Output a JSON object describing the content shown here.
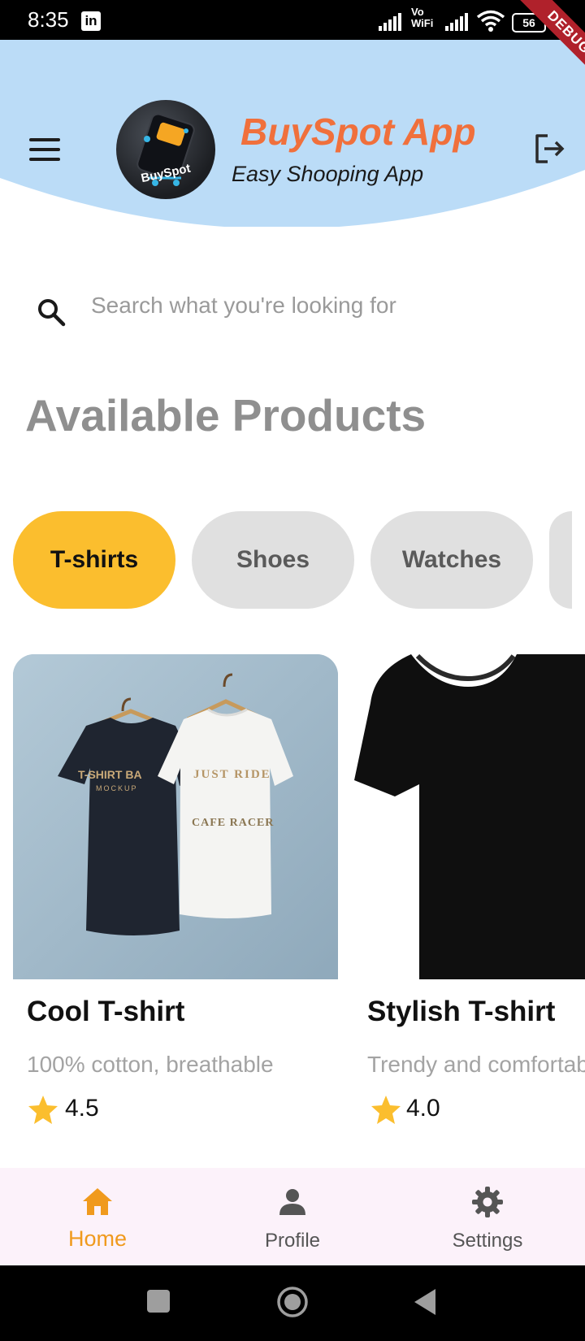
{
  "status_bar": {
    "time": "8:35",
    "notification_icon": "linkedin-icon",
    "network_label_top": "Vo",
    "network_label_bottom": "WiFi",
    "battery_level": "56",
    "debug_ribbon": "DEBUG"
  },
  "header": {
    "title": "BuySpot App",
    "subtitle": "Easy Shooping App",
    "logo_text": "BuySpot",
    "menu_icon": "menu-icon",
    "logout_icon": "logout-icon",
    "background_color": "#bbdcf7",
    "title_color": "#f0703c"
  },
  "search": {
    "placeholder": "Search what you're looking for",
    "value": ""
  },
  "section_title": "Available Products",
  "categories": [
    {
      "label": "T-shirts",
      "active": true
    },
    {
      "label": "Shoes",
      "active": false
    },
    {
      "label": "Watches",
      "active": false
    }
  ],
  "products": [
    {
      "name": "Cool T-shirt",
      "description": "100% cotton, breathable",
      "rating": "4.5",
      "image_text_1": "T-SHIRT BA",
      "image_text_2": "MOCKUP",
      "image_text_3": "JUST RIDE",
      "image_text_4": "CAFE RACER"
    },
    {
      "name": "Stylish T-shirt",
      "description": "Trendy and comfortable",
      "rating": "4.0"
    }
  ],
  "bottom_nav": {
    "items": [
      {
        "label": "Home",
        "icon": "home-icon",
        "active": true
      },
      {
        "label": "Profile",
        "icon": "person-icon",
        "active": false
      },
      {
        "label": "Settings",
        "icon": "gear-icon",
        "active": false
      }
    ],
    "active_color": "#f09a1d"
  },
  "colors": {
    "chip_active": "#fbbe2e",
    "chip_inactive": "#e0e0e0",
    "star": "#fbbe2e"
  }
}
